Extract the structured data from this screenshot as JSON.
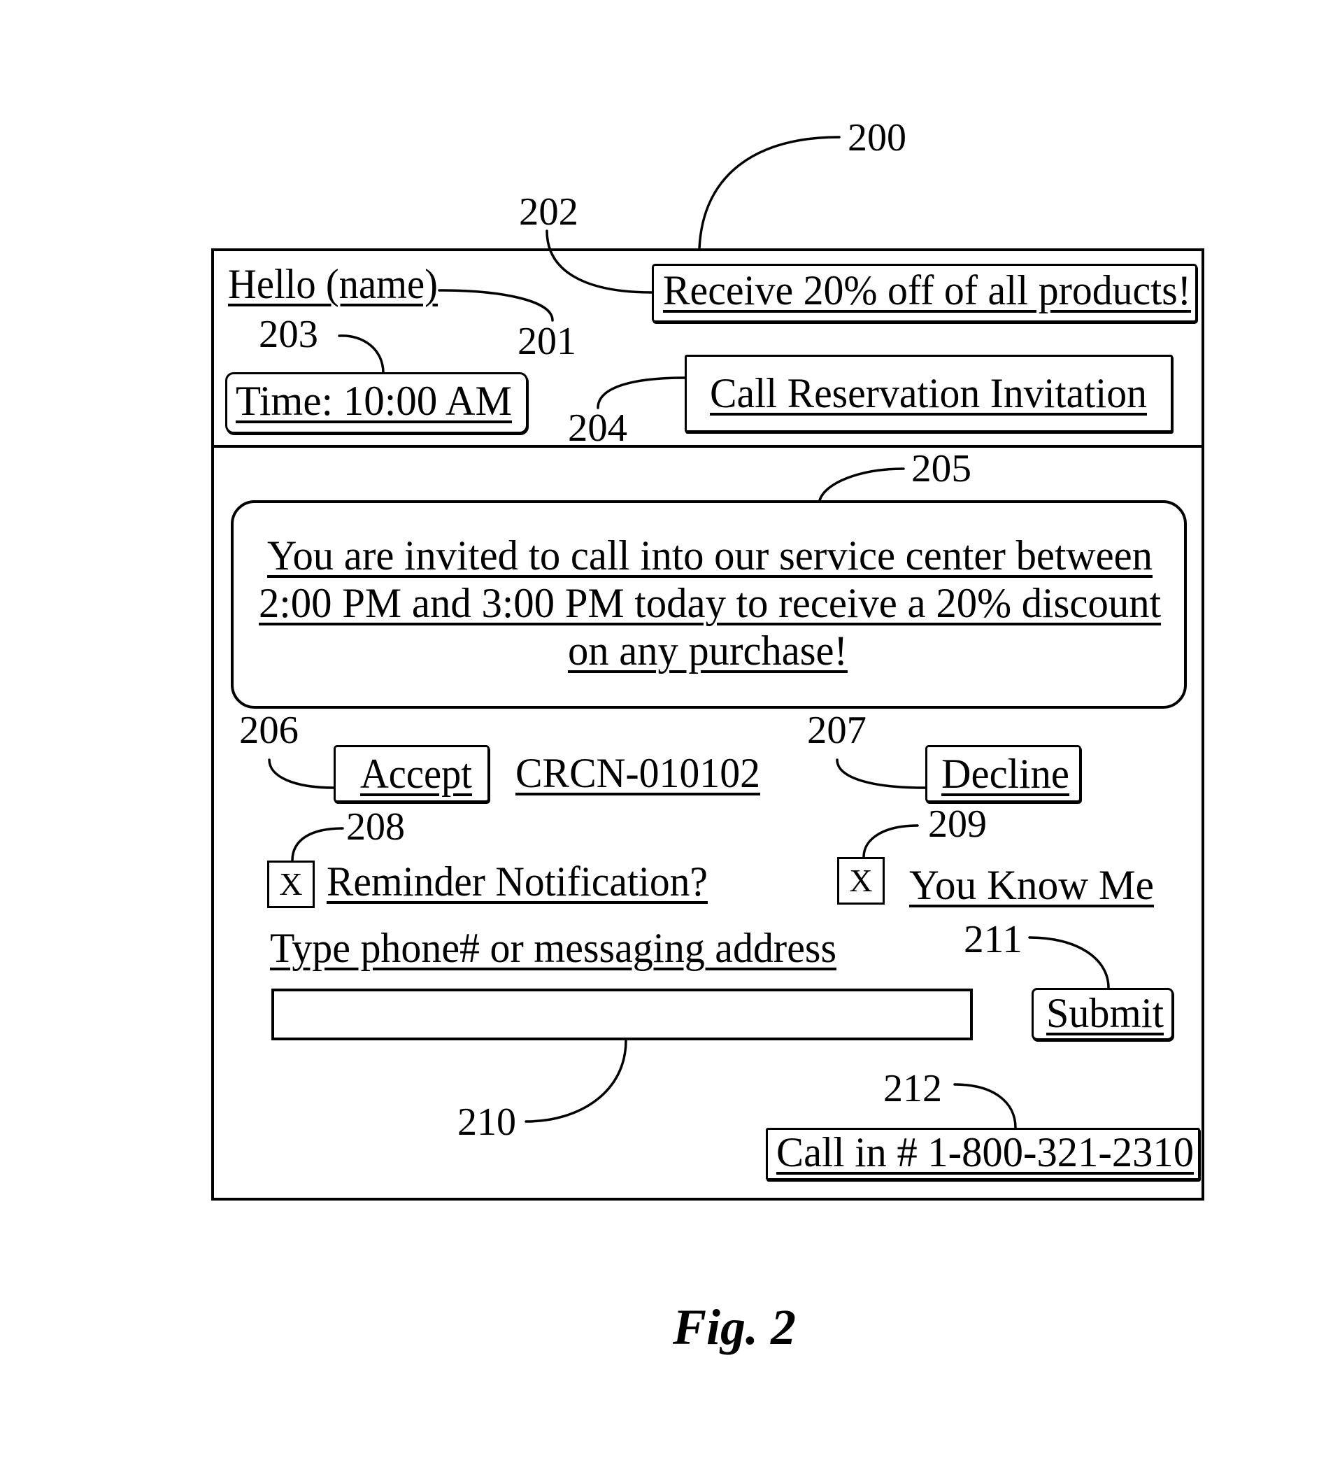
{
  "figure": {
    "caption": "Fig. 2",
    "ref_main": "200"
  },
  "header": {
    "greeting": "Hello (name)",
    "greeting_ref": "201",
    "promo_banner": "Receive 20% off of all products!",
    "promo_ref": "202",
    "time_display": "Time: 10:00 AM",
    "time_ref": "203",
    "title": "Call Reservation Invitation",
    "title_ref": "204"
  },
  "invitation": {
    "message_lines": [
      "You are invited to call into our service center between",
      "2:00 PM and 3:00 PM today to receive a 20% discount",
      "on any purchase!"
    ],
    "message_ref": "205"
  },
  "actions": {
    "accept_label": "Accept",
    "accept_ref": "206",
    "confirmation_code": "CRCN-010102",
    "decline_label": "Decline",
    "decline_ref": "207"
  },
  "options": {
    "reminder": {
      "label": "Reminder Notification?",
      "checked": true,
      "mark": "X",
      "ref": "208"
    },
    "you_know_me": {
      "label": "You Know Me",
      "checked": true,
      "mark": "X",
      "ref": "209"
    }
  },
  "contact": {
    "input_label": "Type phone# or messaging address",
    "input_value": "",
    "input_ref": "210",
    "submit_label": "Submit",
    "submit_ref": "211",
    "call_in": "Call in # 1-800-321-2310",
    "call_in_ref": "212"
  }
}
